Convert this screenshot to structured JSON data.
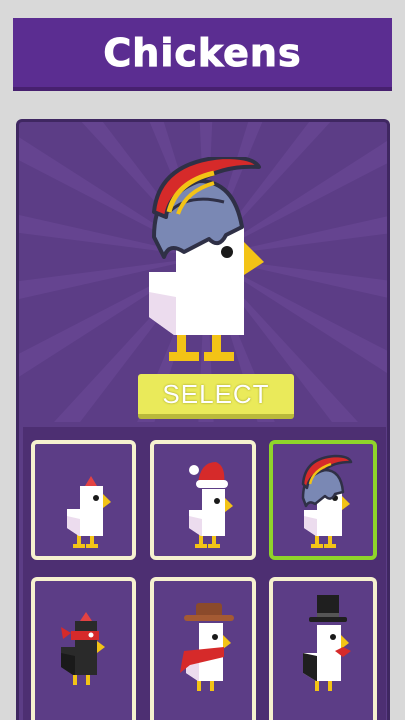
{
  "header": {
    "title": "Chickens"
  },
  "actions": {
    "select_label": "SELECT"
  },
  "colors": {
    "banner": "#5b2d91",
    "panel": "#5c3d86",
    "select_button": "#eaea5a",
    "card_border": "#f6f1cf",
    "selected_border": "#8fd42a"
  },
  "chickens": [
    {
      "name": "classic-chicken",
      "selected": false
    },
    {
      "name": "santa-chicken",
      "selected": false
    },
    {
      "name": "spartan-chicken",
      "selected": true
    },
    {
      "name": "ninja-chicken",
      "selected": false
    },
    {
      "name": "cowboy-chicken",
      "selected": false
    },
    {
      "name": "top-hat-chicken",
      "selected": false
    }
  ]
}
